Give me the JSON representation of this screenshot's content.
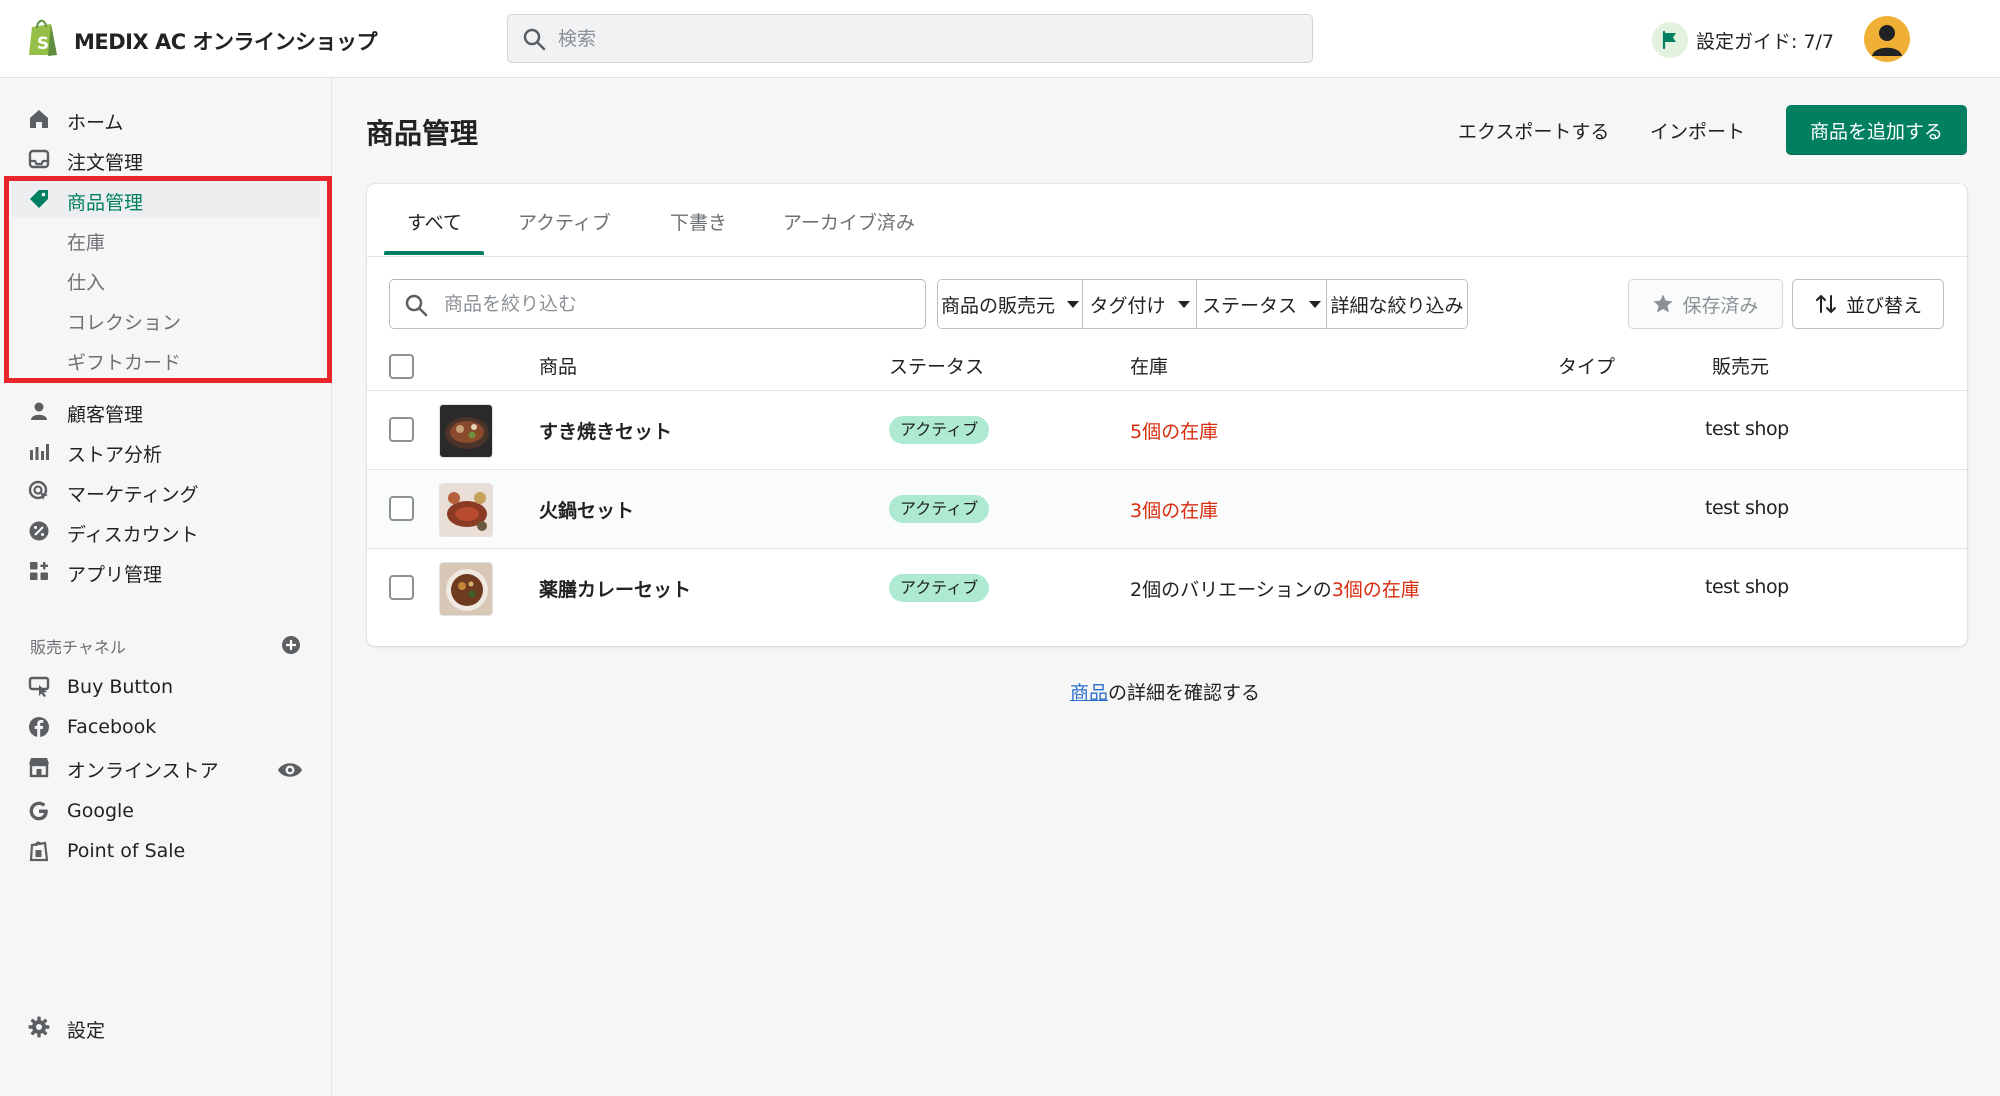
{
  "topbar": {
    "shop_name": "MEDIX AC オンラインショップ",
    "search_placeholder": "検索",
    "setup_guide": "設定ガイド: 7/7"
  },
  "sidebar": {
    "items": [
      {
        "label": "ホーム",
        "icon": "home-icon"
      },
      {
        "label": "注文管理",
        "icon": "orders-icon"
      },
      {
        "label": "商品管理",
        "icon": "tag-icon",
        "active": true
      },
      {
        "label": "在庫",
        "sub": true
      },
      {
        "label": "仕入",
        "sub": true
      },
      {
        "label": "コレクション",
        "sub": true
      },
      {
        "label": "ギフトカード",
        "sub": true
      },
      {
        "label": "顧客管理",
        "icon": "person-icon"
      },
      {
        "label": "ストア分析",
        "icon": "analytics-icon"
      },
      {
        "label": "マーケティング",
        "icon": "marketing-icon"
      },
      {
        "label": "ディスカウント",
        "icon": "discount-icon"
      },
      {
        "label": "アプリ管理",
        "icon": "apps-icon"
      }
    ],
    "channels_label": "販売チャネル",
    "channels": [
      {
        "label": "Buy Button",
        "icon": "buy-button-icon"
      },
      {
        "label": "Facebook",
        "icon": "facebook-icon"
      },
      {
        "label": "オンラインストア",
        "icon": "store-icon"
      },
      {
        "label": "Google",
        "icon": "google-icon"
      },
      {
        "label": "Point of Sale",
        "icon": "pos-icon"
      }
    ],
    "settings_label": "設定"
  },
  "page": {
    "title": "商品管理",
    "export_label": "エクスポートする",
    "import_label": "インポート",
    "add_product_label": "商品を追加する"
  },
  "tabs": [
    "すべて",
    "アクティブ",
    "下書き",
    "アーカイブ済み"
  ],
  "filters": {
    "search_placeholder": "商品を絞り込む",
    "vendor": "商品の販売元",
    "tagged": "タグ付け",
    "status": "ステータス",
    "more": "詳細な絞り込み",
    "saved": "保存済み",
    "sort": "並び替え"
  },
  "table": {
    "headers": {
      "product": "商品",
      "status": "ステータス",
      "inventory": "在庫",
      "type": "タイプ",
      "vendor": "販売元"
    },
    "rows": [
      {
        "name": "すき焼きセット",
        "status": "アクティブ",
        "stock_prefix": "",
        "stock": "5個の在庫",
        "vendor": "test shop"
      },
      {
        "name": "火鍋セット",
        "status": "アクティブ",
        "stock_prefix": "",
        "stock": "3個の在庫",
        "vendor": "test shop"
      },
      {
        "name": "薬膳カレーセット",
        "status": "アクティブ",
        "stock_prefix": "2個のバリエーションの",
        "stock": "3個の在庫",
        "vendor": "test shop"
      }
    ]
  },
  "footer": {
    "link": "商品",
    "text": "の詳細を確認する"
  },
  "colors": {
    "accent": "#008060",
    "stock_warning": "#d72c0d",
    "badge_active": "#aee9d1",
    "highlight": "#e8262c"
  }
}
